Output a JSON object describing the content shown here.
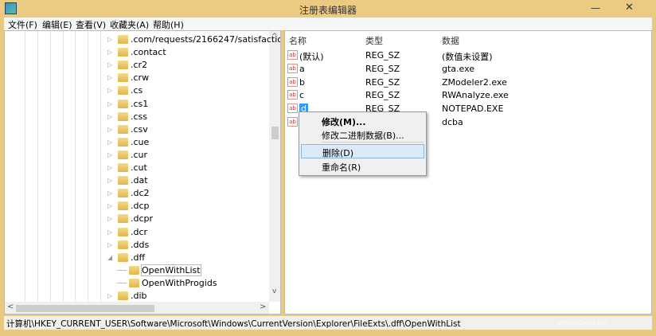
{
  "window": {
    "title": "注册表编辑器",
    "minimize": "—",
    "close": "✕"
  },
  "menu": [
    "文件(F)",
    "编辑(E)",
    "查看(V)",
    "收藏夹(A)",
    "帮助(H)"
  ],
  "tree": {
    "items": [
      {
        "label": ".com/requests/2166247/satisfaction/r",
        "expander": "▷"
      },
      {
        "label": ".contact",
        "expander": "▷"
      },
      {
        "label": ".cr2",
        "expander": "▷"
      },
      {
        "label": ".crw",
        "expander": "▷"
      },
      {
        "label": ".cs",
        "expander": "▷"
      },
      {
        "label": ".cs1",
        "expander": "▷"
      },
      {
        "label": ".css",
        "expander": "▷"
      },
      {
        "label": ".csv",
        "expander": "▷"
      },
      {
        "label": ".cue",
        "expander": "▷"
      },
      {
        "label": ".cur",
        "expander": "▷"
      },
      {
        "label": ".cut",
        "expander": "▷"
      },
      {
        "label": ".dat",
        "expander": "▷"
      },
      {
        "label": ".dc2",
        "expander": "▷"
      },
      {
        "label": ".dcp",
        "expander": "▷"
      },
      {
        "label": ".dcpr",
        "expander": "▷"
      },
      {
        "label": ".dcr",
        "expander": "▷"
      },
      {
        "label": ".dds",
        "expander": "▷"
      },
      {
        "label": ".dff",
        "expander": "◢"
      },
      {
        "label": "OpenWithList",
        "expander": ""
      },
      {
        "label": "OpenWithProgids",
        "expander": ""
      },
      {
        "label": ".dib",
        "expander": "▷"
      }
    ],
    "scroll_up": "^",
    "scroll_down": "v",
    "scroll_left": "<",
    "scroll_right": ">"
  },
  "values": {
    "headers": {
      "name": "名称",
      "type": "类型",
      "data": "数据"
    },
    "icon_text": "ab",
    "rows": [
      {
        "name": "(默认)",
        "type": "REG_SZ",
        "data": "(数值未设置)"
      },
      {
        "name": "a",
        "type": "REG_SZ",
        "data": "gta.exe"
      },
      {
        "name": "b",
        "type": "REG_SZ",
        "data": "ZModeler2.exe"
      },
      {
        "name": "c",
        "type": "REG_SZ",
        "data": "RWAnalyze.exe"
      },
      {
        "name": "d",
        "type": "REG_SZ",
        "data": "NOTEPAD.EXE"
      },
      {
        "name": "",
        "type": "",
        "data": "dcba"
      }
    ]
  },
  "context_menu": [
    "修改(M)...",
    "修改二进制数据(B)...",
    "删除(D)",
    "重命名(R)"
  ],
  "status": "计算机\\HKEY_CURRENT_USER\\Software\\Microsoft\\Windows\\CurrentVersion\\Explorer\\FileExts\\.dff\\OpenWithList",
  "watermark": {
    "main": "系统之家",
    "sub": "XITONGZHIJIA.NET"
  }
}
